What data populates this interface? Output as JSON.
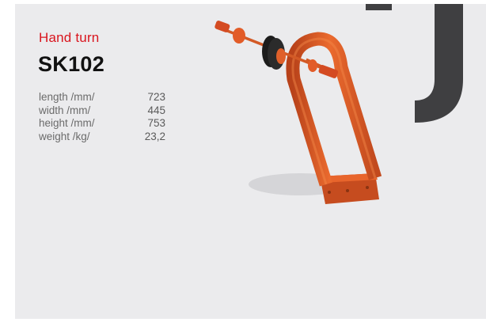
{
  "product": {
    "category": "Hand turn",
    "model": "SK102"
  },
  "specs": [
    {
      "label": "length /mm/",
      "value": "723"
    },
    {
      "label": "width /mm/",
      "value": "445"
    },
    {
      "label": "height /mm/",
      "value": "753"
    },
    {
      "label": "weight /kg/",
      "value": "23,2"
    }
  ],
  "colors": {
    "accent_red": "#d9151e",
    "product_orange": "#e0602a",
    "background": "#ebebed",
    "deco_dark": "#3f3f41"
  },
  "decoration": {
    "letter_glyph": "J"
  }
}
